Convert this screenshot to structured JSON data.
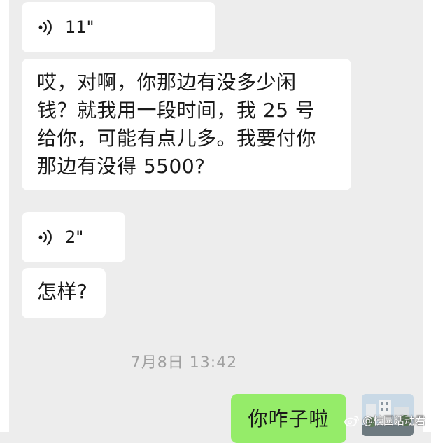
{
  "chat": {
    "messages": [
      {
        "type": "voice",
        "direction": "received",
        "duration": "11\""
      },
      {
        "type": "text",
        "direction": "received",
        "lines": [
          "哎，对啊，你那边有没多少闲",
          "钱？就我用一段时间，我 25 号",
          "给你，可能有点儿多。我要付你",
          "那边有没得 5500?"
        ]
      },
      {
        "type": "voice",
        "direction": "received",
        "duration": "2\""
      },
      {
        "type": "text",
        "direction": "received",
        "text": "怎样?"
      }
    ],
    "timestamp": "7月8日 13:42",
    "sent_message": {
      "type": "text",
      "direction": "sent",
      "text": "你咋子啦"
    }
  },
  "watermark": {
    "text": "@校园活动君",
    "icon": "weibo-logo"
  },
  "colors": {
    "background": "#ededed",
    "received_bubble": "#ffffff",
    "sent_bubble": "#95ec69",
    "timestamp": "#a0a0a0"
  }
}
